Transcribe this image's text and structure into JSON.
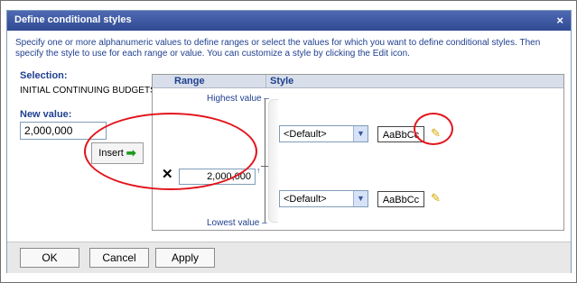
{
  "dialog": {
    "title": "Define conditional styles",
    "close_glyph": "×",
    "instructions": "Specify one or more alphanumeric values to define ranges or select the values for which you want to define conditional styles. Then specify the style to use for each range or value. You can customize a style by clicking the Edit icon."
  },
  "left": {
    "selection_label": "Selection:",
    "selection_value": "INITIAL CONTINUING BUDGETS",
    "new_value_label": "New value:",
    "new_value": "2,000,000",
    "insert_label": "Insert",
    "insert_icon": "right-arrow-icon"
  },
  "grid": {
    "range_header": "Range",
    "style_header": "Style",
    "highest_label": "Highest value",
    "lowest_label": "Lowest value",
    "dash": "–",
    "delete_glyph": "✕",
    "range_value": "2,000,000",
    "up_glyph": "↑",
    "style_rows": [
      {
        "select_value": "<Default>",
        "sample_text": "AaBbCc",
        "edit_icon": "pencil-icon"
      },
      {
        "select_value": "<Default>",
        "sample_text": "AaBbCc",
        "edit_icon": "pencil-icon"
      }
    ]
  },
  "footer": {
    "ok": "OK",
    "cancel": "Cancel",
    "apply": "Apply"
  },
  "colors": {
    "title_bar": "#3a56a3",
    "accent_text": "#1f3f8f",
    "annotation": "#e3141c",
    "insert_arrow": "#1a9a1a",
    "edit_pencil": "#d4a800"
  }
}
